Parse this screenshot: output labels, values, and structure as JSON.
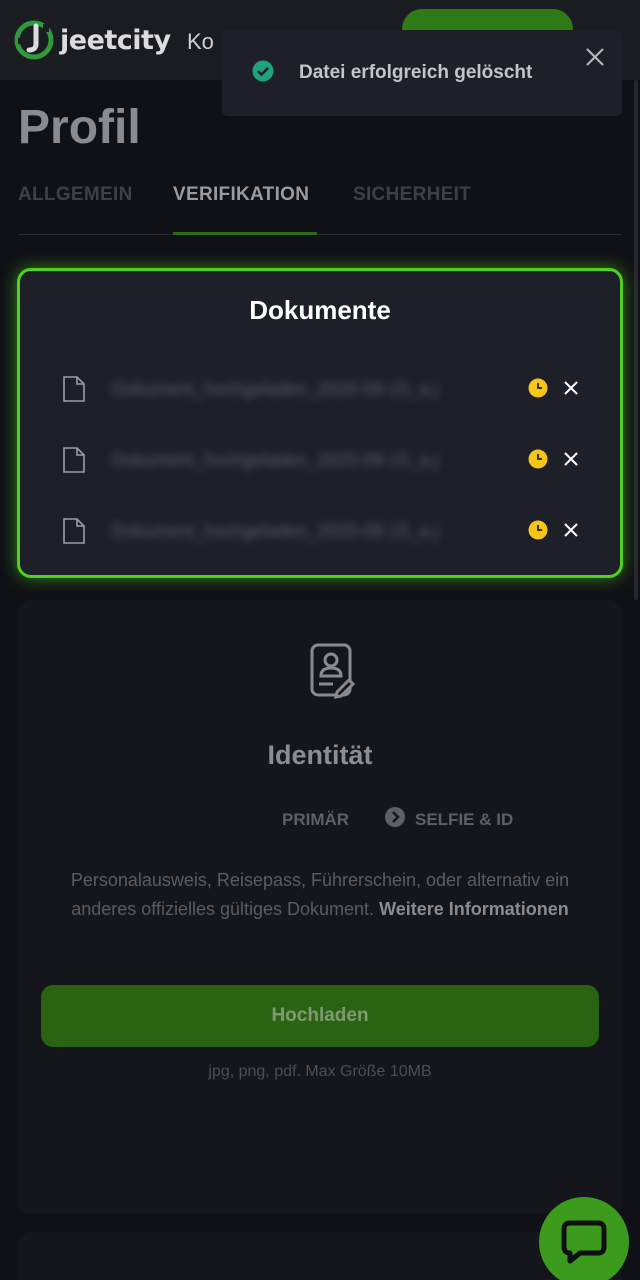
{
  "header": {
    "logo_text": "jeetcity",
    "nav_truncated": "Ko"
  },
  "page": {
    "title": "Profil",
    "tabs": [
      {
        "label": "ALLGEMEIN",
        "active": false
      },
      {
        "label": "VERIFIKATION",
        "active": true
      },
      {
        "label": "SICHERHEIT",
        "active": false
      }
    ]
  },
  "toast": {
    "message": "Datei erfolgreich gelöscht",
    "icon": "check-circle-icon",
    "color": "#1fa37a"
  },
  "modal": {
    "title": "Dokumente",
    "documents": [
      {
        "name": "Dokument_hochgeladen_2020-09-15_a.j",
        "status": "pending"
      },
      {
        "name": "Dokument_hochgeladen_2020-09-15_a.j",
        "status": "pending"
      },
      {
        "name": "Dokument_hochgeladen_2020-09-15_a.j",
        "status": "pending"
      }
    ],
    "border_color": "#4fd11e",
    "pending_color": "#f5c518"
  },
  "identity_card": {
    "title": "Identität",
    "step_primary": "PRIMÄR",
    "step_selfie": "SELFIE & ID",
    "description": "Personalausweis, Reisepass, Führerschein, oder alternativ ein anderes offizielles gültiges Dokument.",
    "more_info": "Weitere Informationen",
    "upload_label": "Hochladen",
    "hint": "jpg, png, pdf. Max Größe 10MB"
  },
  "colors": {
    "accent": "#3c9a1c",
    "background": "#0e0f13"
  }
}
